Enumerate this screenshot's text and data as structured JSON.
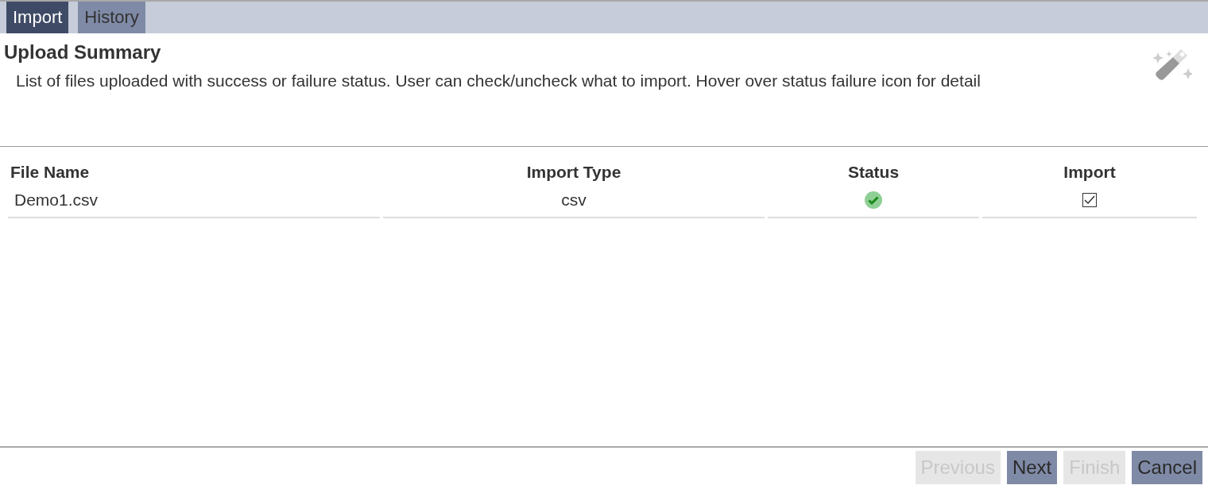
{
  "tabs": [
    {
      "label": "Import",
      "selected": true
    },
    {
      "label": "History",
      "selected": false
    }
  ],
  "title": "Upload Summary",
  "description": "List of files uploaded with success or failure status. User can check/uncheck what to import. Hover over status failure icon for detail",
  "table": {
    "columns": [
      "File Name",
      "Import Type",
      "Status",
      "Import"
    ],
    "rows": [
      {
        "file_name": "Demo1.csv",
        "import_type": "csv",
        "kind": "success",
        "checked": true
      }
    ]
  },
  "buttons": [
    {
      "label": "Previous",
      "disabled": true
    },
    {
      "label": "Next",
      "disabled": false
    },
    {
      "label": "Finish",
      "disabled": true
    },
    {
      "label": "Cancel",
      "disabled": false
    }
  ]
}
